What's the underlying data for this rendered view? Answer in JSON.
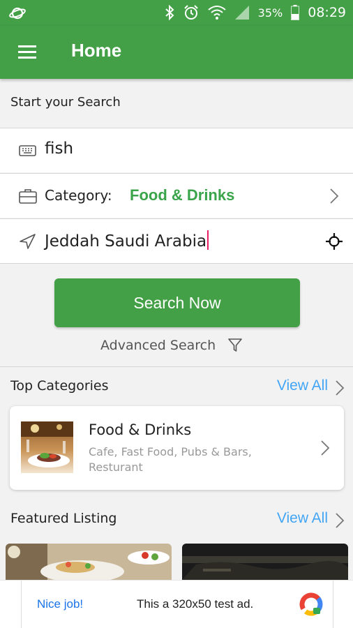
{
  "status_bar": {
    "battery": "35%",
    "time": "08:29"
  },
  "app_bar": {
    "title": "Home"
  },
  "search": {
    "heading": "Start your Search",
    "keyword": "fish",
    "category_label": "Category:",
    "category_value": "Food & Drinks",
    "location": "Jeddah Saudi Arabia",
    "button_label": "Search Now",
    "advanced_label": "Advanced Search"
  },
  "top_categories": {
    "title": "Top Categories",
    "view_all": "View All",
    "items": [
      {
        "title": "Food & Drinks",
        "subtitle": "Cafe, Fast Food, Pubs & Bars, Resturant"
      }
    ]
  },
  "featured": {
    "title": "Featured Listing",
    "view_all": "View All"
  },
  "ad": {
    "left": "Nice job!",
    "text": "This a 320x50 test ad."
  },
  "colors": {
    "primary": "#43a047",
    "accent_green": "#3aa44b",
    "link_blue": "#42a5f5",
    "cursor_pink": "#e91e63"
  }
}
